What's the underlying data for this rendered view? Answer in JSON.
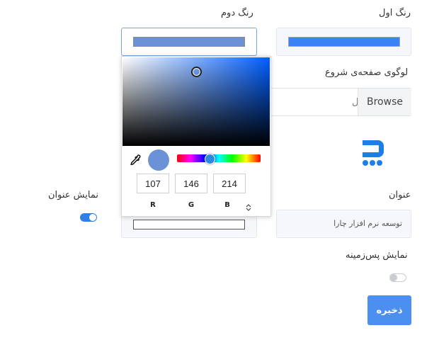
{
  "first_color": {
    "label": "رنگ اول",
    "value": "#3b82f6"
  },
  "second_color": {
    "label": "رنگ دوم",
    "value": "#6b92d6"
  },
  "start_logo": {
    "label": "لوگوی صفحه‌ی شروع",
    "browse_label": "Browse",
    "logo_icon": "chara-logo-icon",
    "logo_color": "#1d7fe5"
  },
  "title_field": {
    "label": "عنوان",
    "value": "توسعه نرم افزار چارا"
  },
  "show_title": {
    "label": "نمایش عنوان",
    "enabled": true
  },
  "show_background": {
    "label": "نمایش پس‌زمینه",
    "enabled": false
  },
  "save_button": {
    "label": "ذخیره"
  },
  "color_picker": {
    "eyedropper_icon": "eyedropper-icon",
    "preview_color": "#6b92d6",
    "r": "107",
    "g": "146",
    "b": "214",
    "r_label": "R",
    "g_label": "G",
    "b_label": "B",
    "mode_toggle_icon": "up-down-arrows-icon",
    "hue_color": "#005eff"
  }
}
